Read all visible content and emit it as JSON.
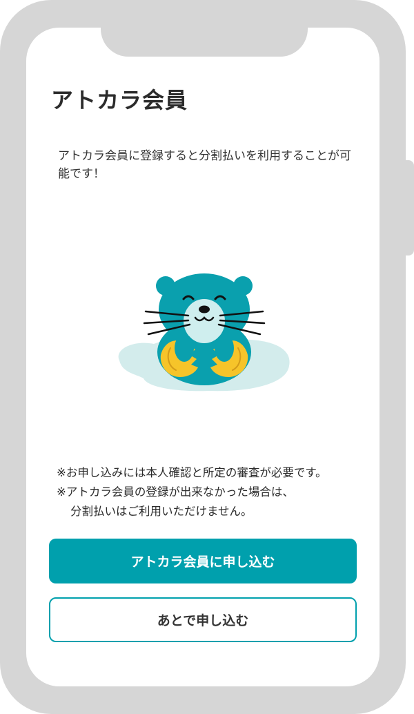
{
  "page": {
    "title": "アトカラ会員",
    "intro": "アトカラ会員に登録すると分割払いを利用することが可能です！"
  },
  "notes": {
    "line1": "※お申し込みには本人確認と所定の審査が必要です。",
    "line2": "※アトカラ会員の登録が出来なかった場合は、",
    "line3": "分割払いはご利用いただけません。"
  },
  "buttons": {
    "apply_label": "アトカラ会員に申し込む",
    "later_label": "あとで申し込む"
  },
  "mascot": {
    "icon": "otter-mascot-illustration"
  },
  "colors": {
    "accent": "#00a0ad",
    "frame": "#d6d6d6",
    "mascot_body": "#0aa0ae",
    "mascot_face": "#cfeeee",
    "float_ring": "#f6c42a",
    "puddle": "#d3ecec"
  }
}
